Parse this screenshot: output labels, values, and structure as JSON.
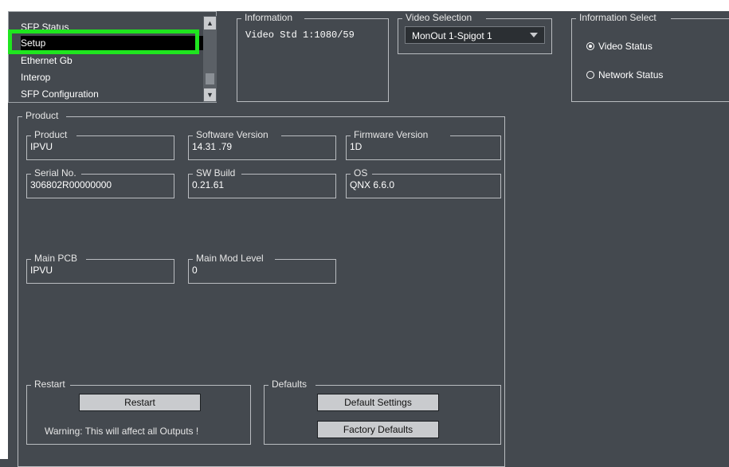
{
  "nav_list": {
    "items": [
      {
        "label": "SFP Status",
        "selected": false
      },
      {
        "label": "Setup",
        "selected": true
      },
      {
        "label": "Ethernet Gb",
        "selected": false
      },
      {
        "label": "Interop",
        "selected": false
      },
      {
        "label": "SFP Configuration",
        "selected": false
      }
    ],
    "highlight_color": "#1fe51f"
  },
  "information": {
    "title": "Information",
    "text": "Video Std 1:1080/59"
  },
  "video_selection": {
    "title": "Video Selection",
    "selected": "MonOut 1-Spigot 1"
  },
  "information_select": {
    "title": "Information Select",
    "options": [
      {
        "label": "Video Status",
        "checked": true
      },
      {
        "label": "Network Status",
        "checked": false
      }
    ]
  },
  "product": {
    "title": "Product",
    "fields": {
      "product": {
        "label": "Product",
        "value": "IPVU"
      },
      "software_version": {
        "label": "Software Version",
        "value": "14.31 .79"
      },
      "firmware_version": {
        "label": "Firmware Version",
        "value": "1D"
      },
      "serial_no": {
        "label": "Serial No.",
        "value": "306802R00000000"
      },
      "sw_build": {
        "label": "SW Build",
        "value": "0.21.61"
      },
      "os": {
        "label": "OS",
        "value": "QNX 6.6.0"
      },
      "main_pcb": {
        "label": "Main PCB",
        "value": "IPVU"
      },
      "main_mod_level": {
        "label": "Main Mod Level",
        "value": "0"
      }
    }
  },
  "restart": {
    "title": "Restart",
    "button": "Restart",
    "warning": "Warning: This will affect all Outputs !"
  },
  "defaults": {
    "title": "Defaults",
    "default_settings_button": "Default Settings",
    "factory_defaults_button": "Factory Defaults"
  },
  "colors": {
    "panel_bg": "#44494f",
    "selection_bg": "#000000",
    "button_bg": "#c9cbce"
  }
}
